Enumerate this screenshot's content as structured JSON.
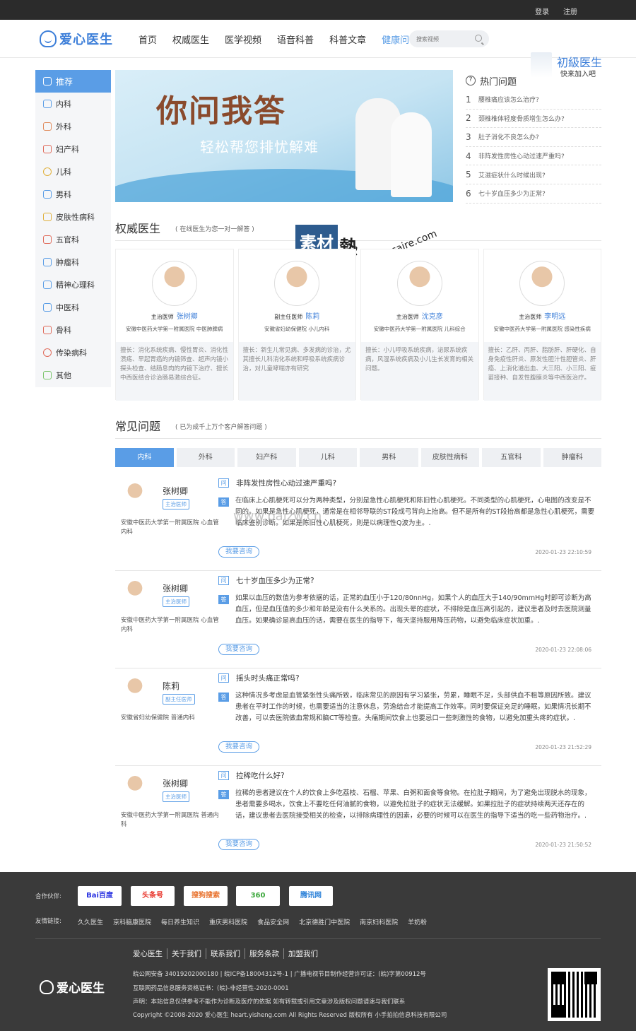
{
  "topbar": {
    "login": "登录",
    "register": "注册"
  },
  "logo": {
    "text": "爱心医生"
  },
  "nav": {
    "items": [
      "首页",
      "权威医生",
      "医学视频",
      "语音科普",
      "科普文章",
      "健康问答"
    ],
    "active": "健康问答"
  },
  "search": {
    "placeholder": "搜索视频"
  },
  "header_slogan": {
    "line1": "初級医生",
    "line2": "快来加入吧"
  },
  "sidebar": {
    "items": [
      "推荐",
      "内科",
      "外科",
      "妇产科",
      "儿科",
      "男科",
      "皮肤性病科",
      "五官科",
      "肿瘤科",
      "精神心理科",
      "中医科",
      "骨科",
      "传染病科",
      "其他"
    ]
  },
  "banner": {
    "title": "你问我答",
    "subtitle": "轻松帮您排忧解难"
  },
  "hot": {
    "title": "热门问题",
    "items": [
      {
        "n": "1",
        "q": "腰椎痛应该怎么治疗?"
      },
      {
        "n": "2",
        "q": "颈椎椎体轻度骨质增生怎么办?"
      },
      {
        "n": "3",
        "q": "肚子消化不良怎么办?"
      },
      {
        "n": "4",
        "q": "非阵发性房性心动过速严重吗?"
      },
      {
        "n": "5",
        "q": "艾滋症状什么时候出现?"
      },
      {
        "n": "6",
        "q": "七十岁血压多少为正常?"
      }
    ]
  },
  "authority": {
    "title": "权威医生",
    "subtitle": "( 在线医生为您一对一解答 )",
    "doctors": [
      {
        "title": "主治医师",
        "name": "张树卿",
        "hospital": "安徽中医药大学第一附属医院 中医肺脾病",
        "expertise": "擅长：消化系统疾病、慢性胃炎、消化性溃疡、早起胃癌的内镜筛查、超声内镜小探头检查、结肠息肉的内镜下治疗、擅长中西医结合诊治肠易激综合征。"
      },
      {
        "title": "副主任医师",
        "name": "陈莉",
        "hospital": "安徽省妇幼保健院 小儿内科",
        "expertise": "擅长：新生儿常见病、多发病的诊治，尤其擅长儿科消化系统和呼吸系统疾病诊治，对儿童哮喘亦有研究"
      },
      {
        "title": "主治医师",
        "name": "沈克彦",
        "hospital": "安徽中医药大学第一附属医院 儿科综合",
        "expertise": "擅长：小儿呼吸系统疾病，泌尿系统疾病，风湿系统疾病及小儿生长发育的相关问题。"
      },
      {
        "title": "主治医师",
        "name": "李明远",
        "hospital": "安徽中医药大学第一附属医院 感染性疾病",
        "expertise": "擅长：乙肝、丙肝、脂肪肝、肝硬化、自身免疫性肝炎、原发性胆汁性胆管炎、肝癌、上消化道出血、大三阳、小三阳、疫苗接种、自发性腹膜炎等中西医治疗。"
      }
    ]
  },
  "watermark": {
    "cn": "素材",
    "cn2": "熱",
    "en": "sucaire.com"
  },
  "common": {
    "title": "常见问题",
    "subtitle": "( 已为成千上万个客户解答问题 )",
    "tabs": [
      "内科",
      "外科",
      "妇产科",
      "儿科",
      "男科",
      "皮肤性病科",
      "五官科",
      "肿瘤科"
    ],
    "q_marker": "问",
    "a_marker": "答",
    "consult_label": "我要咨询",
    "items": [
      {
        "doctor": "张树卿",
        "badge": "主治医师",
        "hospital": "安徽中医药大学第一附属医院 心血管内科",
        "question": "非阵发性房性心动过速严重吗?",
        "answer": "在临床上心肌梗死可以分为两种类型，分别是急性心肌梗死和陈旧性心肌梗死。不同类型的心肌梗死，心电图的改变是不同的。如果是急性心肌梗死，通常是在相邻导联的ST段成弓背向上抬高。但不是所有的ST段抬高都是急性心肌梗死，需要临床鉴别诊断。如果是陈旧性心肌梗死，则是以病理性Q波为主。.",
        "time": "2020-01-23 22:10:59"
      },
      {
        "doctor": "张树卿",
        "badge": "主治医师",
        "hospital": "安徽中医药大学第一附属医院 心血管内科",
        "question": "七十岁血压多少为正常?",
        "answer": "如果以血压的数值为参考依据的话，正常的血压小于120/80nnHg，如果个人的血压大于140/90mmHg时即可诊断为高血压，但是血压值的多少和年龄是没有什么关系的。出现头晕的症状，不排除是血压高引起的，建议患者及时去医院测量血压。如果确诊是高血压的话，需要在医生的指导下，每天坚持服用降压药物，以避免临床症状加重。.",
        "time": "2020-01-23 22:08:06"
      },
      {
        "doctor": "陈莉",
        "badge": "副主任医师",
        "hospital": "安徽省妇幼保健院 普通内科",
        "question": "摇头时头痛正常吗?",
        "answer": "这种情况多考虑是血管紧张性头痛所致，临床常见的原因有学习紧张，劳累，睡眠不足，头部供血不租等原因所致。建议患者在平时工作的时候，也需要适当的注意休息，劳逸结合才能提高工作效率。同时要保证充足的睡眠，如果情况长期不改善，可以去医院做血常规和脑CT等检查。头痛期间饮食上也要忌口一些刺激性的食物，以避免加重头疼的症状。.",
        "time": "2020-01-23 21:52:29"
      },
      {
        "doctor": "张树卿",
        "badge": "主治医师",
        "hospital": "安徽中医药大学第一附属医院 普通内科",
        "question": "拉稀吃什么好?",
        "answer": "拉稀的患者建议在个人的饮食上多吃荔枝、石榴、苹果、白粥和面食等食物。在拉肚子期间，为了避免出现脱水的现象，患者需要多喝水，饮食上不要吃任何油腻的食物，以避免拉肚子的症状无法缓解。如果拉肚子的症状持续两天还存在的话，建议患者去医院接受相关的检查，以排除病理性的因素，必要的时候可以在医生的指导下适当的吃一些药物治疗。.",
        "time": "2020-01-23 21:50:52"
      }
    ]
  },
  "paizw": {
    "text": "www.paizw.cn"
  },
  "footer": {
    "partners_label": "合作伙伴:",
    "partners": [
      "Bai百度",
      "头条号",
      "搜狗搜索",
      "360",
      "腾讯网"
    ],
    "links_label": "友情链接:",
    "links": [
      "久久医生",
      "京科脑康医院",
      "每日养生知识",
      "重庆男科医院",
      "食品安全网",
      "北京德胜门中医院",
      "南京妇科医院",
      "羊奶粉"
    ],
    "menu": [
      "爱心医生",
      "关于我们",
      "联系我们",
      "服务条款",
      "加盟我们"
    ],
    "line1": "皖公网安备 34019202000180 | 皖ICP备18004312号-1 | 广播电视节目制作经营许可证：(皖)字第00912号",
    "line2": "互联网药品信息服务资格证书：(皖)-非经营性-2020-0001",
    "line3": "声明：本站信息仅供参考不能作为诊断及医疗的依据 如有转载或引用文章涉及版权问题请速与我们联系",
    "line4": "Copyright ©2008-2020 爱心医生 heart.yisheng.com All Rights Reserved 版权所有 小手拍拍信息科技有限公司",
    "logo_text": "爱心医生"
  }
}
